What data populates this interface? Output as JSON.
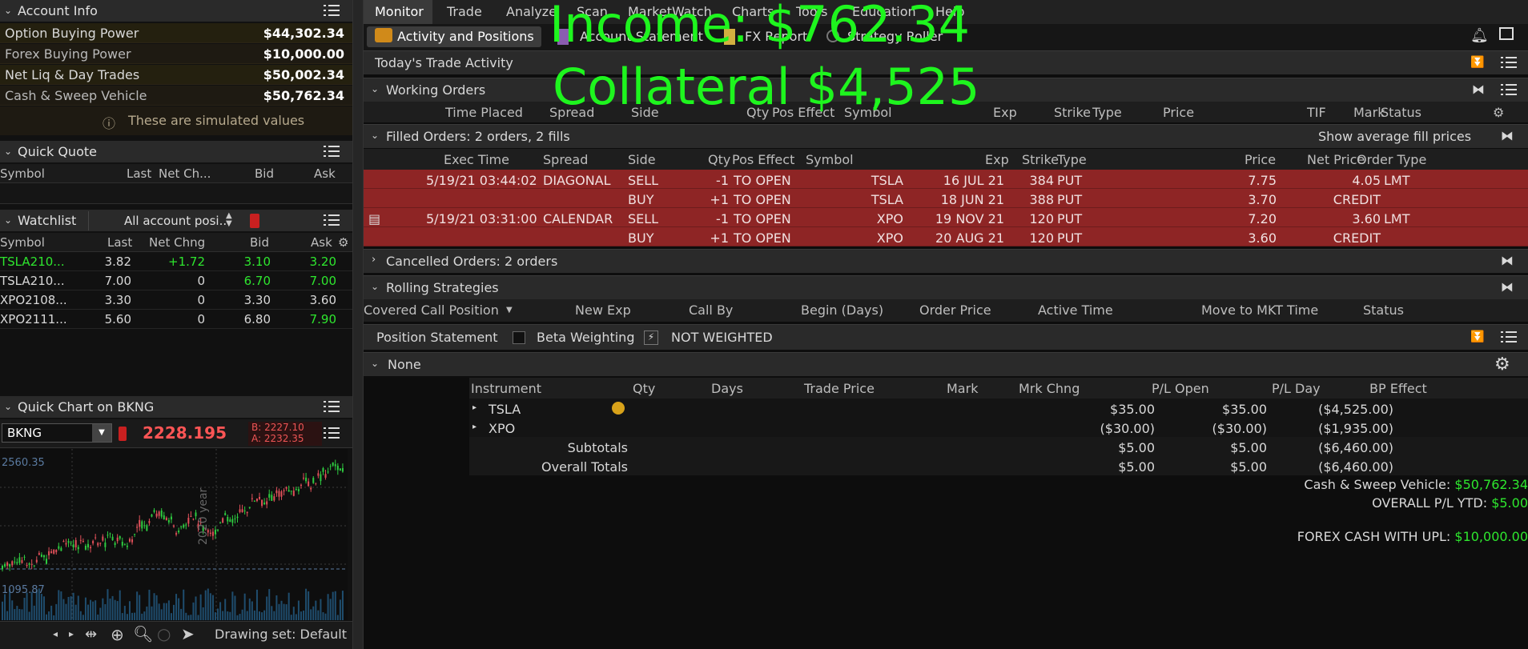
{
  "account_info": {
    "title": "Account Info",
    "rows": [
      {
        "label": "Option Buying Power",
        "value": "$44,302.34"
      },
      {
        "label": "Forex Buying Power",
        "value": "$10,000.00"
      },
      {
        "label": "Net Liq & Day Trades",
        "value": "$50,002.34"
      },
      {
        "label": "Cash & Sweep Vehicle",
        "value": "$50,762.34"
      }
    ],
    "simulated_note": "These are simulated values"
  },
  "quick_quote": {
    "title": "Quick Quote",
    "columns": [
      "Symbol",
      "Last",
      "Net Ch...",
      "Bid",
      "Ask"
    ]
  },
  "watchlist": {
    "title": "Watchlist",
    "selector": "All account posi...",
    "columns": [
      "Symbol",
      "Last",
      "Net Chng",
      "Bid",
      "Ask"
    ],
    "rows": [
      {
        "symbol": "TSLA210...",
        "last": "3.82",
        "chg": "+1.72",
        "bid": "3.10",
        "ask": "3.20"
      },
      {
        "symbol": "TSLA210...",
        "last": "7.00",
        "chg": "0",
        "bid": "6.70",
        "ask": "7.00"
      },
      {
        "symbol": "XPO2108...",
        "last": "3.30",
        "chg": "0",
        "bid": "3.30",
        "ask": "3.60"
      },
      {
        "symbol": "XPO2111...",
        "last": "5.60",
        "chg": "0",
        "bid": "6.80",
        "ask": "7.90"
      }
    ]
  },
  "quick_chart": {
    "title": "Quick Chart on BKNG",
    "symbol": "BKNG",
    "price": "2228.195",
    "bid": "B: 2227.10",
    "ask": "A: 2232.35",
    "high_label": "2560.35",
    "low_label": "1095.87",
    "period": "2020 year",
    "drawing_set": "Drawing set: Default"
  },
  "tabs": [
    "Monitor",
    "Trade",
    "Analyze",
    "Scan",
    "MarketWatch",
    "Charts",
    "Tools",
    "Education",
    "Help"
  ],
  "subtabs": [
    "Activity and Positions",
    "Account Statement",
    "FX Report",
    "Strategy Roller"
  ],
  "todays_activity": "Today's Trade Activity",
  "working_orders": {
    "title": "Working Orders",
    "columns": [
      "Time Placed",
      "Spread",
      "Side",
      "Qty",
      "Pos Effect",
      "Symbol",
      "Exp",
      "Strike",
      "Type",
      "Price",
      "TIF",
      "Mark",
      "Status"
    ]
  },
  "filled_orders": {
    "title": "Filled Orders: 2 orders, 2 fills",
    "avg_fill": "Show average fill prices",
    "columns": [
      "Exec Time",
      "Spread",
      "Side",
      "Qty",
      "Pos Effect",
      "Symbol",
      "Exp",
      "Strike",
      "Type",
      "Price",
      "Net Price",
      "Order Type"
    ],
    "rows": [
      {
        "time": "5/19/21 03:44:02",
        "spread": "DIAGONAL",
        "side": "SELL",
        "qty": "-1",
        "pos": "TO OPEN",
        "symbol": "TSLA",
        "exp": "16 JUL 21",
        "strike": "384",
        "type": "PUT",
        "price": "7.75",
        "net": "4.05",
        "otype": "LMT"
      },
      {
        "time": "",
        "spread": "",
        "side": "BUY",
        "qty": "+1",
        "pos": "TO OPEN",
        "symbol": "TSLA",
        "exp": "18 JUN 21",
        "strike": "388",
        "type": "PUT",
        "price": "3.70",
        "net": "CREDIT",
        "otype": ""
      },
      {
        "time": "5/19/21 03:31:00",
        "spread": "CALENDAR",
        "side": "SELL",
        "qty": "-1",
        "pos": "TO OPEN",
        "symbol": "XPO",
        "exp": "19 NOV 21",
        "strike": "120",
        "type": "PUT",
        "price": "7.20",
        "net": "3.60",
        "otype": "LMT"
      },
      {
        "time": "",
        "spread": "",
        "side": "BUY",
        "qty": "+1",
        "pos": "TO OPEN",
        "symbol": "XPO",
        "exp": "20 AUG 21",
        "strike": "120",
        "type": "PUT",
        "price": "3.60",
        "net": "CREDIT",
        "otype": ""
      }
    ]
  },
  "cancelled_orders": "Cancelled Orders: 2 orders",
  "rolling": {
    "title": "Rolling Strategies",
    "columns": [
      "Covered Call Position",
      "New Exp",
      "Call By",
      "Begin (Days)",
      "Order Price",
      "Active Time",
      "Move to MKT Time",
      "Status"
    ]
  },
  "position_statement": {
    "title": "Position Statement",
    "beta": "Beta Weighting",
    "weighted": "NOT WEIGHTED",
    "group": "None",
    "columns": [
      "Instrument",
      "Qty",
      "Days",
      "Trade Price",
      "Mark",
      "Mrk Chng",
      "P/L Open",
      "P/L Day",
      "BP Effect"
    ],
    "rows": [
      {
        "name": "TSLA",
        "pl_open": "$35.00",
        "pl_day": "$35.00",
        "bp": "($4,525.00)"
      },
      {
        "name": "XPO",
        "pl_open": "($30.00)",
        "pl_day": "($30.00)",
        "bp": "($1,935.00)"
      }
    ],
    "subtotals": {
      "label": "Subtotals",
      "pl_open": "$5.00",
      "pl_day": "$5.00",
      "bp": "($6,460.00)"
    },
    "overall": {
      "label": "Overall Totals",
      "pl_open": "$5.00",
      "pl_day": "$5.00",
      "bp": "($6,460.00)"
    },
    "cash_label": "Cash & Sweep Vehicle:",
    "cash_value": "$50,762.34",
    "ytd_label": "OVERALL P/L YTD:",
    "ytd_value": "$5.00",
    "forex_label": "FOREX CASH WITH UPL:",
    "forex_value": "$10,000.00"
  },
  "overlay": {
    "line1": "Income: $762.34",
    "line2": "Collateral $4,525"
  },
  "colors": {
    "accent_green": "#1ef51e",
    "fill_red": "#8e2525",
    "price_red": "#ff5555"
  }
}
